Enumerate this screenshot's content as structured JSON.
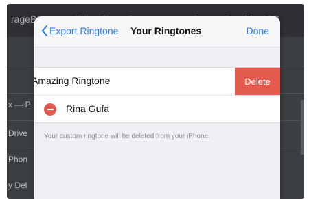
{
  "background_app": {
    "title_left": "rageBa",
    "title_mid": "Edit  < Share Setup",
    "title_right": "GarageBand for iOS",
    "side_items": [
      "x — P",
      "Drive",
      "Phon",
      "y Del"
    ]
  },
  "sheet": {
    "back_label": "Export Ringtone",
    "title": "Your Ringtones",
    "done_label": "Done",
    "rows": [
      {
        "label": "Amazing Ringtone",
        "action": "Delete"
      },
      {
        "label": "Rina Gufa"
      }
    ],
    "note": "Your custom ringtone will be deleted from your iPhone."
  },
  "colors": {
    "accent": "#2a7cff",
    "destructive": "#e25b4e",
    "sheet_bg": "#efeff4",
    "background_app": "#3b3e42"
  },
  "icons": {
    "back": "chevron-left-icon",
    "delete_control": "minus-circle-icon"
  }
}
